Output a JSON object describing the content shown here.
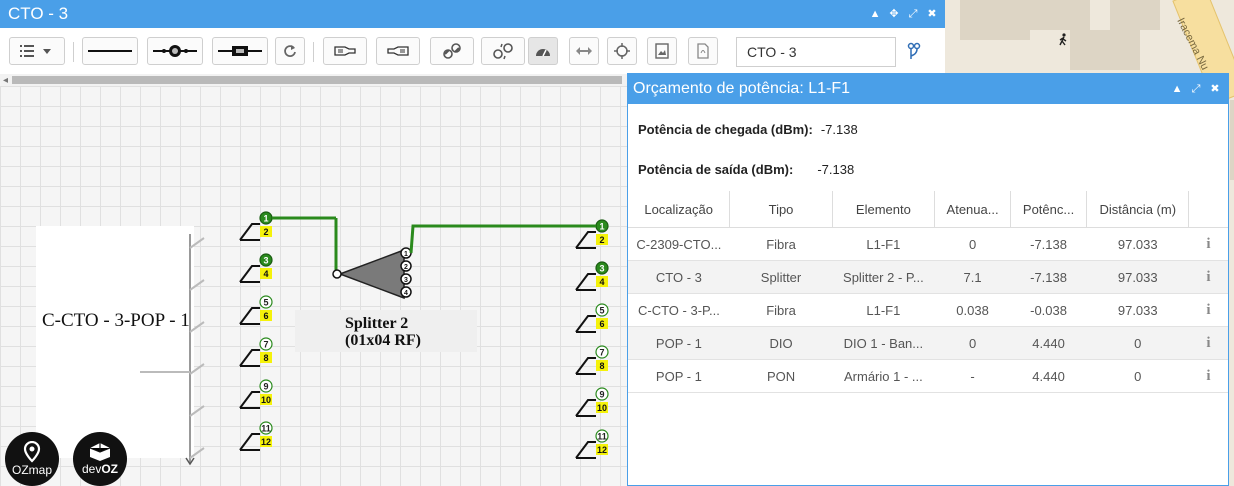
{
  "window": {
    "title": "CTO - 3",
    "search_value": "CTO - 3"
  },
  "canvas": {
    "cable_label": "C-CTO - 3-POP - 1",
    "splitter_label_line1": "Splitter 2",
    "splitter_label_line2": "(01x04 RF)",
    "left_ports": [
      "1",
      "2",
      "3",
      "4",
      "5",
      "6",
      "7",
      "8",
      "9",
      "10",
      "11",
      "12"
    ],
    "right_ports": [
      "1",
      "2",
      "3",
      "4",
      "5",
      "6",
      "7",
      "8",
      "9",
      "10",
      "11",
      "12"
    ],
    "splitter_ports": [
      "1",
      "2",
      "3",
      "4"
    ]
  },
  "badges": {
    "ozmap": "OZmap",
    "devoz_prefix": "dev",
    "devoz_suffix": "OZ"
  },
  "map": {
    "street_label": "Iracema Nu"
  },
  "panel": {
    "title": "Orçamento de potência: L1-F1",
    "arrival_label": "Potência de chegada (dBm):",
    "arrival_value": "-7.138",
    "output_label": "Potência de saída (dBm):",
    "output_value": "-7.138",
    "columns": [
      "Localização",
      "Tipo",
      "Elemento",
      "Atenua...",
      "Potênc...",
      "Distância (m)",
      ""
    ],
    "rows": [
      {
        "loc": "C-2309-CTO...",
        "tipo": "Fibra",
        "elem": "L1-F1",
        "aten": "0",
        "pot": "-7.138",
        "dist": "97.033"
      },
      {
        "loc": "CTO - 3",
        "tipo": "Splitter",
        "elem": "Splitter 2 - P...",
        "aten": "7.1",
        "pot": "-7.138",
        "dist": "97.033"
      },
      {
        "loc": "C-CTO - 3-P...",
        "tipo": "Fibra",
        "elem": "L1-F1",
        "aten": "0.038",
        "pot": "-0.038",
        "dist": "97.033"
      },
      {
        "loc": "POP - 1",
        "tipo": "DIO",
        "elem": "DIO 1 - Ban...",
        "aten": "0",
        "pot": "4.440",
        "dist": "0"
      },
      {
        "loc": "POP - 1",
        "tipo": "PON",
        "elem": "Armário 1 - ...",
        "aten": "-",
        "pot": "4.440",
        "dist": "0"
      }
    ]
  },
  "colors": {
    "titlebar": "#4a9fe8",
    "fiber_green": "#2a8a1d",
    "port_yellow": "#f5f20a"
  }
}
